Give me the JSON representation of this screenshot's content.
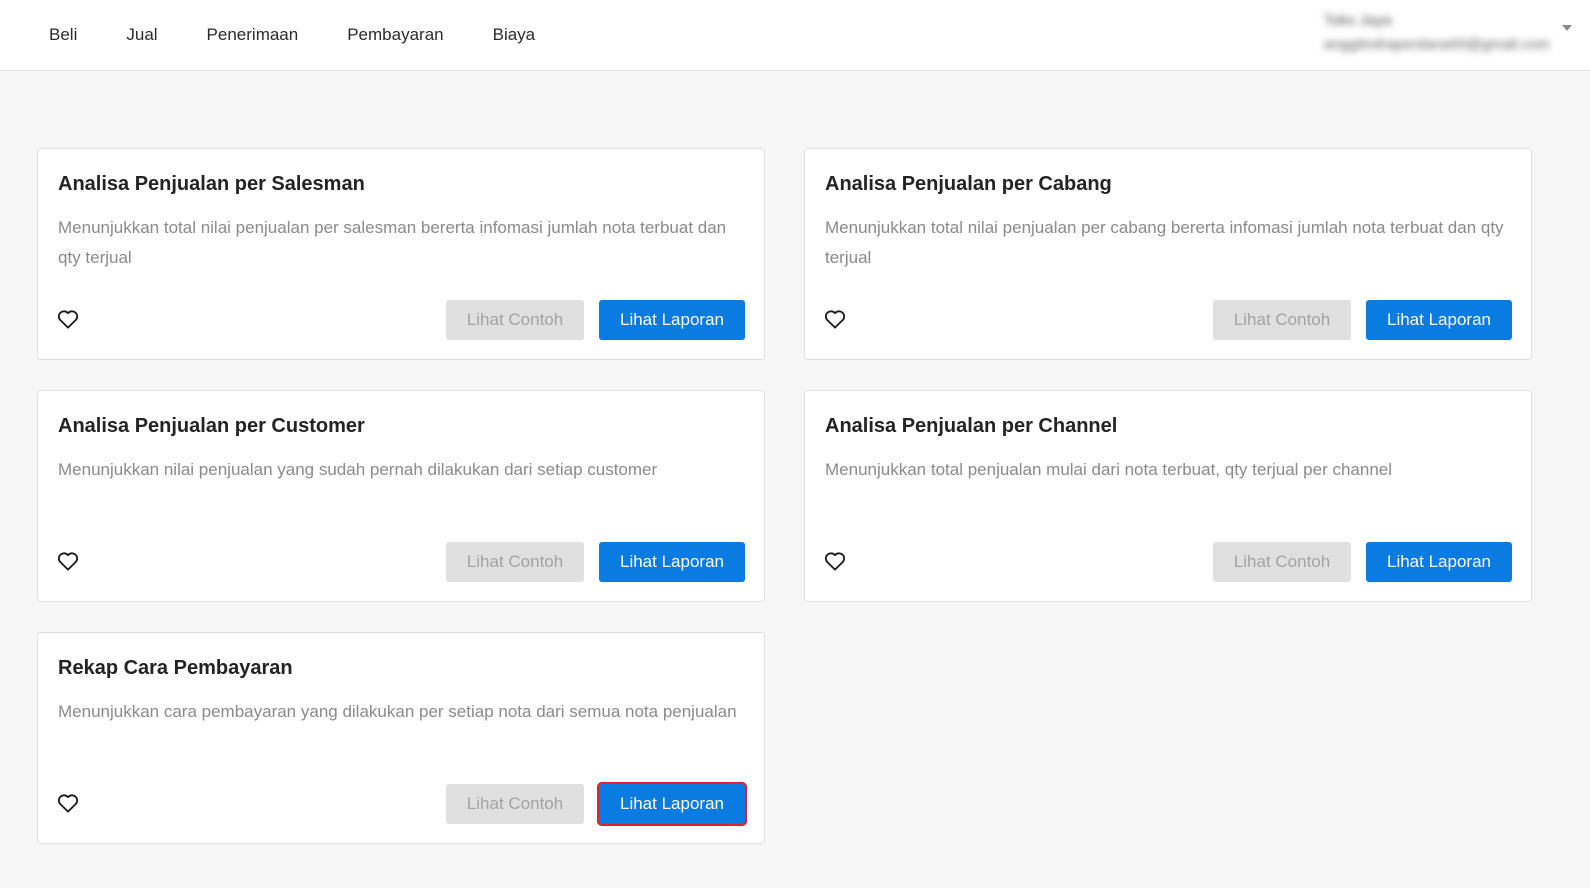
{
  "nav": {
    "items": [
      "Beli",
      "Jual",
      "Penerimaan",
      "Pembayaran",
      "Biaya"
    ]
  },
  "account": {
    "name": "Toko Jaya",
    "email": "anggitndraperdana00@gmail.com",
    "note": "blurred in screenshot"
  },
  "icons": {
    "favorite": "heart-outline-icon",
    "dropdown": "caret-down-icon"
  },
  "colors": {
    "primary": "#0a7be0",
    "disabled_bg": "#e0e0e0",
    "disabled_text": "#a3a3a3",
    "highlight": "#e0202a",
    "page_bg": "#f7f7f7"
  },
  "cards": [
    {
      "title": "Analisa Penjualan per Salesman",
      "description": "Menunjukkan total nilai penjualan per salesman bererta infomasi jumlah nota terbuat dan qty terjual",
      "example_label": "Lihat Contoh",
      "report_label": "Lihat Laporan"
    },
    {
      "title": "Analisa Penjualan per Cabang",
      "description": "Menunjukkan total nilai penjualan per cabang bererta infomasi jumlah nota terbuat dan qty terjual",
      "example_label": "Lihat Contoh",
      "report_label": "Lihat Laporan"
    },
    {
      "title": "Analisa Penjualan per Customer",
      "description": "Menunjukkan nilai penjualan yang sudah pernah dilakukan dari setiap customer",
      "example_label": "Lihat Contoh",
      "report_label": "Lihat Laporan"
    },
    {
      "title": "Analisa Penjualan per Channel",
      "description": "Menunjukkan total penjualan mulai dari nota terbuat, qty terjual per channel",
      "example_label": "Lihat Contoh",
      "report_label": "Lihat Laporan"
    },
    {
      "title": "Rekap Cara Pembayaran",
      "description": "Menunjukkan cara pembayaran yang dilakukan per setiap nota dari semua nota penjualan",
      "example_label": "Lihat Contoh",
      "report_label": "Lihat Laporan",
      "report_highlighted": true
    }
  ]
}
